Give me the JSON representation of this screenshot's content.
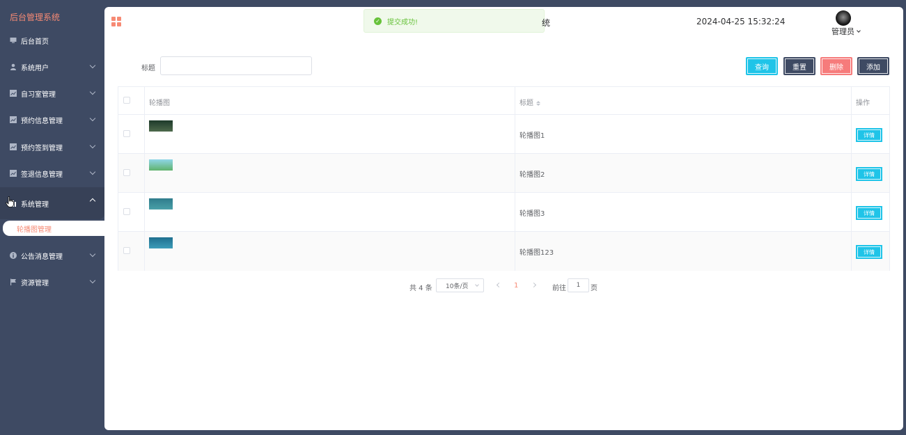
{
  "sidebar": {
    "app_title": "后台管理系统",
    "items": [
      {
        "label": "后台首页",
        "icon": "monitor-icon",
        "has_chevron": false
      },
      {
        "label": "系统用户",
        "icon": "user-icon",
        "has_chevron": true
      },
      {
        "label": "自习室管理",
        "icon": "chart-icon",
        "has_chevron": true
      },
      {
        "label": "预约信息管理",
        "icon": "chart-icon",
        "has_chevron": true
      },
      {
        "label": "预约签到管理",
        "icon": "chart-icon",
        "has_chevron": true
      },
      {
        "label": "签退信息管理",
        "icon": "chart-icon",
        "has_chevron": true
      },
      {
        "label": "系统管理",
        "icon": "bar-chart-icon",
        "has_chevron": true,
        "open": true
      },
      {
        "label": "公告消息管理",
        "icon": "info-icon",
        "has_chevron": true
      },
      {
        "label": "资源管理",
        "icon": "flag-icon",
        "has_chevron": true
      }
    ],
    "submenu_active": "轮播图管理"
  },
  "header": {
    "toast": "提交成功!",
    "system_title_tail": "统",
    "datetime": "2024-04-25 15:32:24",
    "user_name": "管理员"
  },
  "search": {
    "label": "标题",
    "value": "",
    "placeholder": ""
  },
  "toolbar": {
    "query_label": "查询",
    "reset_label": "重置",
    "delete_label": "删除",
    "add_label": "添加"
  },
  "table": {
    "columns": [
      "轮播图",
      "标题",
      "操作"
    ],
    "rows": [
      {
        "title": "轮播图1",
        "action": "详情",
        "thumb_colors": [
          "#1d3a2a",
          "#4e6a4c"
        ]
      },
      {
        "title": "轮播图2",
        "action": "详情",
        "thumb_colors": [
          "#8fd6e8",
          "#5fb36c"
        ]
      },
      {
        "title": "轮播图3",
        "action": "详情",
        "thumb_colors": [
          "#2f7c8c",
          "#4aa0a8"
        ]
      },
      {
        "title": "轮播图123",
        "action": "详情",
        "thumb_colors": [
          "#1f6f8f",
          "#3d9cb8"
        ]
      }
    ]
  },
  "pagination": {
    "total": "共 4 条",
    "page_size": "10条/页",
    "current_page": "1",
    "goto_label": "前往",
    "goto_value": "1",
    "page_unit": "页"
  },
  "colors": {
    "sidebar_bg": "#3e4a63",
    "accent": "#f68a74",
    "primary": "#1fc4e8",
    "danger": "#f67b7b",
    "success": "#67c23a"
  }
}
